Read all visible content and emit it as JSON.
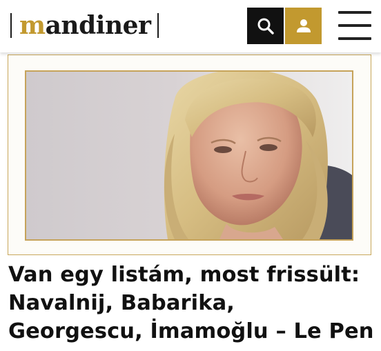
{
  "brand": {
    "logo_first_letter": "m",
    "logo_rest": "andiner",
    "accent_color": "#c2992f",
    "text_color": "#1a1a1a"
  },
  "header": {
    "search_icon": "search-icon",
    "user_icon": "user-icon",
    "menu_icon": "hamburger-menu-icon"
  },
  "article": {
    "image_alt": "Marine Le Pen portrait",
    "headline": "Van egy listám, most frissült: Navalnij, Babarika, Georgescu, İmamoğlu – Le Pen"
  }
}
